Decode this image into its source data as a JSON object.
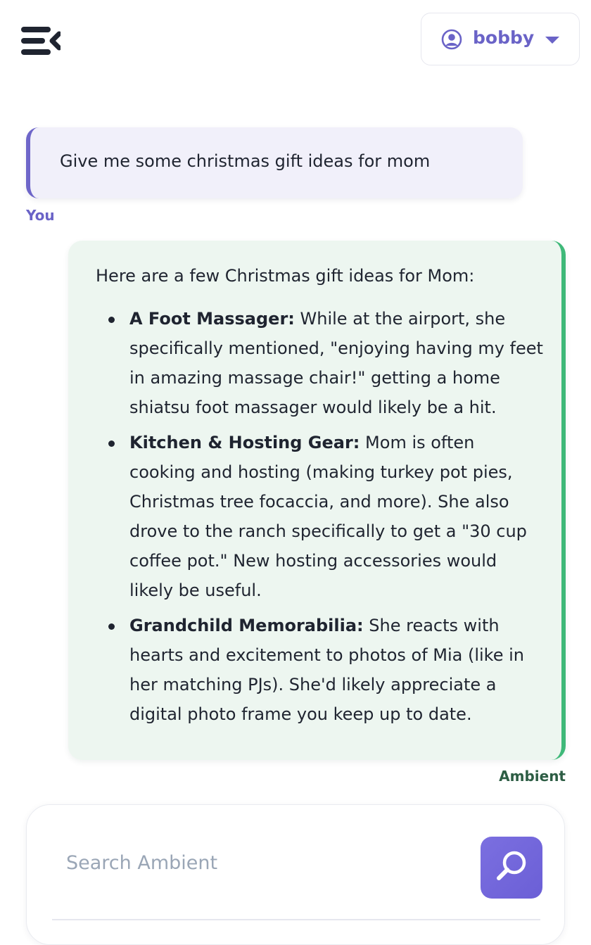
{
  "header": {
    "menu_icon": "collapse-menu-icon",
    "user": {
      "name": "bobby",
      "icon": "user-circle-icon",
      "caret_icon": "chevron-down-icon"
    }
  },
  "conversation": {
    "user_message": {
      "text": "Give me some christmas gift ideas for mom",
      "sender": "You"
    },
    "assistant_message": {
      "intro": "Here are a few Christmas gift ideas for Mom:",
      "items": [
        {
          "title": "A Foot Massager:",
          "body": "While at the airport, she specifically mentioned, \"enjoying having my feet in amazing massage chair!\" getting a home shiatsu foot massager would likely be a hit."
        },
        {
          "title": "Kitchen & Hosting Gear:",
          "body": "Mom is often cooking and hosting (making turkey pot pies, Christmas tree focaccia, and more). She also drove to the ranch specifically to get a \"30 cup coffee pot.\" New hosting accessories would likely be useful."
        },
        {
          "title": "Grandchild Memorabilia:",
          "body": "She reacts with hearts and excitement to photos of Mia (like in her matching PJs). She'd likely appreciate a digital photo frame you keep up to date."
        }
      ],
      "sender": "Ambient"
    }
  },
  "search": {
    "placeholder": "Search Ambient",
    "button_icon": "search-icon"
  },
  "colors": {
    "accent": "#6a63c7",
    "user_bubble_bg": "#f1f0fa",
    "assistant_bubble_bg": "#edf6f0",
    "assistant_border": "#3fb979",
    "search_button": "#6b5fd6"
  }
}
